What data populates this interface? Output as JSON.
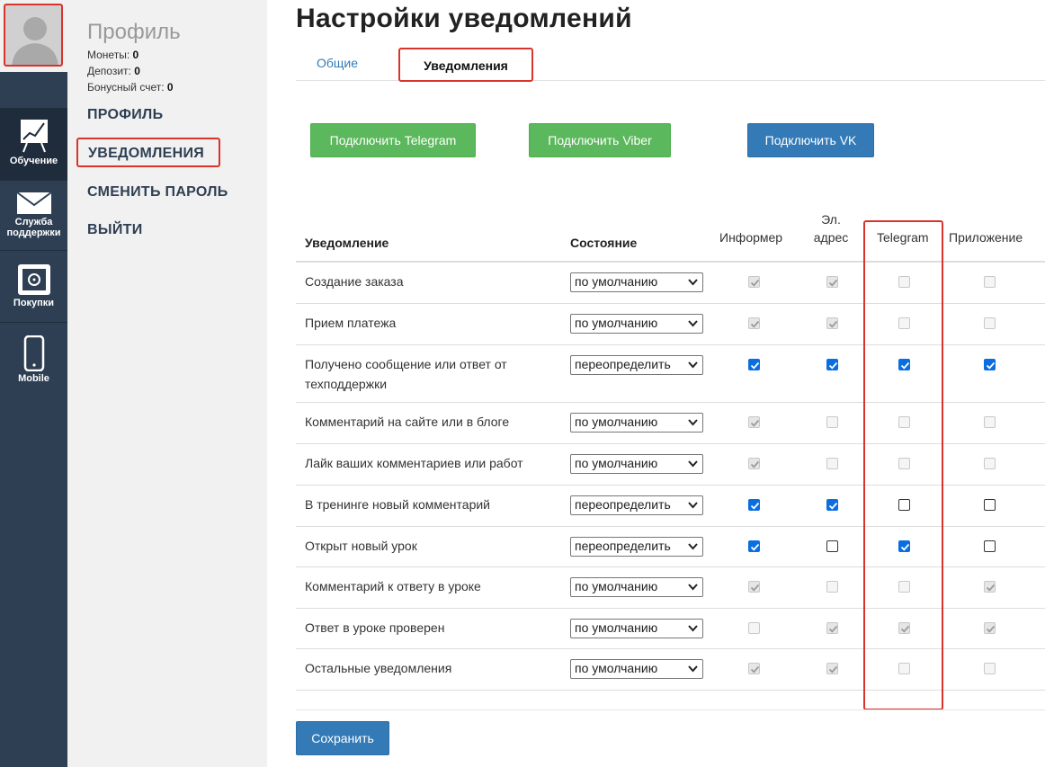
{
  "sidebar": {
    "items": [
      {
        "label": "Обучение",
        "icon": "chart-board-icon"
      },
      {
        "label": "Служба поддержки",
        "icon": "envelope-icon"
      },
      {
        "label": "Покупки",
        "icon": "safe-icon"
      },
      {
        "label": "Mobile",
        "icon": "phone-icon"
      }
    ]
  },
  "profile": {
    "title": "Профиль",
    "coins_label": "Монеты:",
    "coins": "0",
    "deposit_label": "Депозит:",
    "deposit": "0",
    "bonus_label": "Бонусный счет:",
    "bonus": "0",
    "menu": [
      "ПРОФИЛЬ",
      "УВЕДОМЛЕНИЯ",
      "СМЕНИТЬ ПАРОЛЬ",
      "ВЫЙТИ"
    ]
  },
  "page": {
    "title": "Настройки уведомлений",
    "tabs": [
      "Общие",
      "Уведомления"
    ],
    "connect": {
      "telegram": "Подключить Telegram",
      "viber": "Подключить Viber",
      "vk": "Подключить VK"
    },
    "save": "Сохранить"
  },
  "table": {
    "headers": {
      "name": "Уведомление",
      "state": "Состояние",
      "informer": "Информер",
      "email_line1": "Эл.",
      "email_line2": "адрес",
      "telegram": "Telegram",
      "app": "Приложение"
    },
    "rows": [
      {
        "name": "Создание заказа",
        "state": "по умолчанию",
        "checks": [
          "on-dis",
          "on-dis",
          "off-dis",
          "off-dis"
        ]
      },
      {
        "name": "Прием платежа",
        "state": "по умолчанию",
        "checks": [
          "on-dis",
          "on-dis",
          "off-dis",
          "off-dis"
        ]
      },
      {
        "name": "Получено сообщение или ответ от техподдержки",
        "state": "переопределить",
        "checks": [
          "on-en",
          "on-en",
          "on-en",
          "on-en"
        ]
      },
      {
        "name": "Комментарий на сайте или в блоге",
        "state": "по умолчанию",
        "checks": [
          "on-dis",
          "off-dis",
          "off-dis",
          "off-dis"
        ]
      },
      {
        "name": "Лайк ваших комментариев или работ",
        "state": "по умолчанию",
        "checks": [
          "on-dis",
          "off-dis",
          "off-dis",
          "off-dis"
        ]
      },
      {
        "name": "В тренинге новый комментарий",
        "state": "переопределить",
        "checks": [
          "on-en",
          "on-en",
          "off-en",
          "off-en"
        ]
      },
      {
        "name": "Открыт новый урок",
        "state": "переопределить",
        "checks": [
          "on-en",
          "off-en",
          "on-en",
          "off-en"
        ]
      },
      {
        "name": "Комментарий к ответу в уроке",
        "state": "по умолчанию",
        "checks": [
          "on-dis",
          "off-dis",
          "off-dis",
          "on-dis"
        ]
      },
      {
        "name": "Ответ в уроке проверен",
        "state": "по умолчанию",
        "checks": [
          "off-dis",
          "on-dis",
          "on-dis",
          "on-dis"
        ]
      },
      {
        "name": "Остальные уведомления",
        "state": "по умолчанию",
        "checks": [
          "on-dis",
          "on-dis",
          "off-dis",
          "off-dis"
        ]
      }
    ]
  }
}
